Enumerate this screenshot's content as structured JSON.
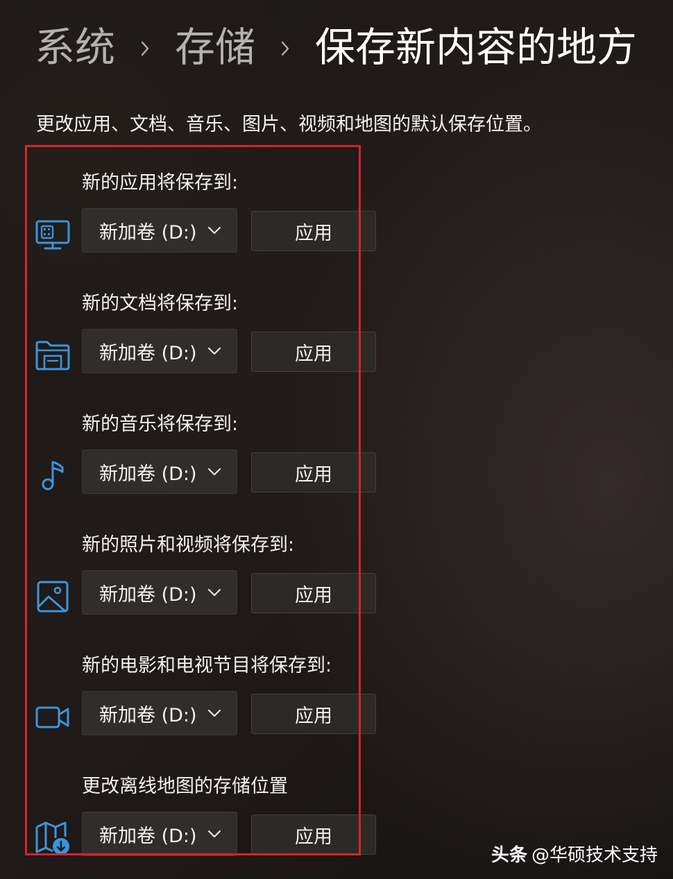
{
  "breadcrumb": {
    "items": [
      "系统",
      "存储",
      "保存新内容的地方"
    ]
  },
  "description": "更改应用、文档、音乐、图片、视频和地图的默认保存位置。",
  "rows": [
    {
      "label": "新的应用将保存到:",
      "icon": "apps-monitor-icon",
      "drive": "新加卷 (D:)",
      "apply": "应用"
    },
    {
      "label": "新的文档将保存到:",
      "icon": "documents-folder-icon",
      "drive": "新加卷 (D:)",
      "apply": "应用"
    },
    {
      "label": "新的音乐将保存到:",
      "icon": "music-note-icon",
      "drive": "新加卷 (D:)",
      "apply": "应用"
    },
    {
      "label": "新的照片和视频将保存到:",
      "icon": "photo-icon",
      "drive": "新加卷 (D:)",
      "apply": "应用"
    },
    {
      "label": "新的电影和电视节目将保存到:",
      "icon": "video-camera-icon",
      "drive": "新加卷 (D:)",
      "apply": "应用"
    },
    {
      "label": "更改离线地图的存储位置",
      "icon": "offline-map-icon",
      "drive": "新加卷 (D:)",
      "apply": "应用"
    }
  ],
  "watermark": {
    "brand": "头条",
    "handle": "@华硕技术支持"
  },
  "colors": {
    "accent": "#3a96dd",
    "highlight_border": "#d8232a"
  }
}
